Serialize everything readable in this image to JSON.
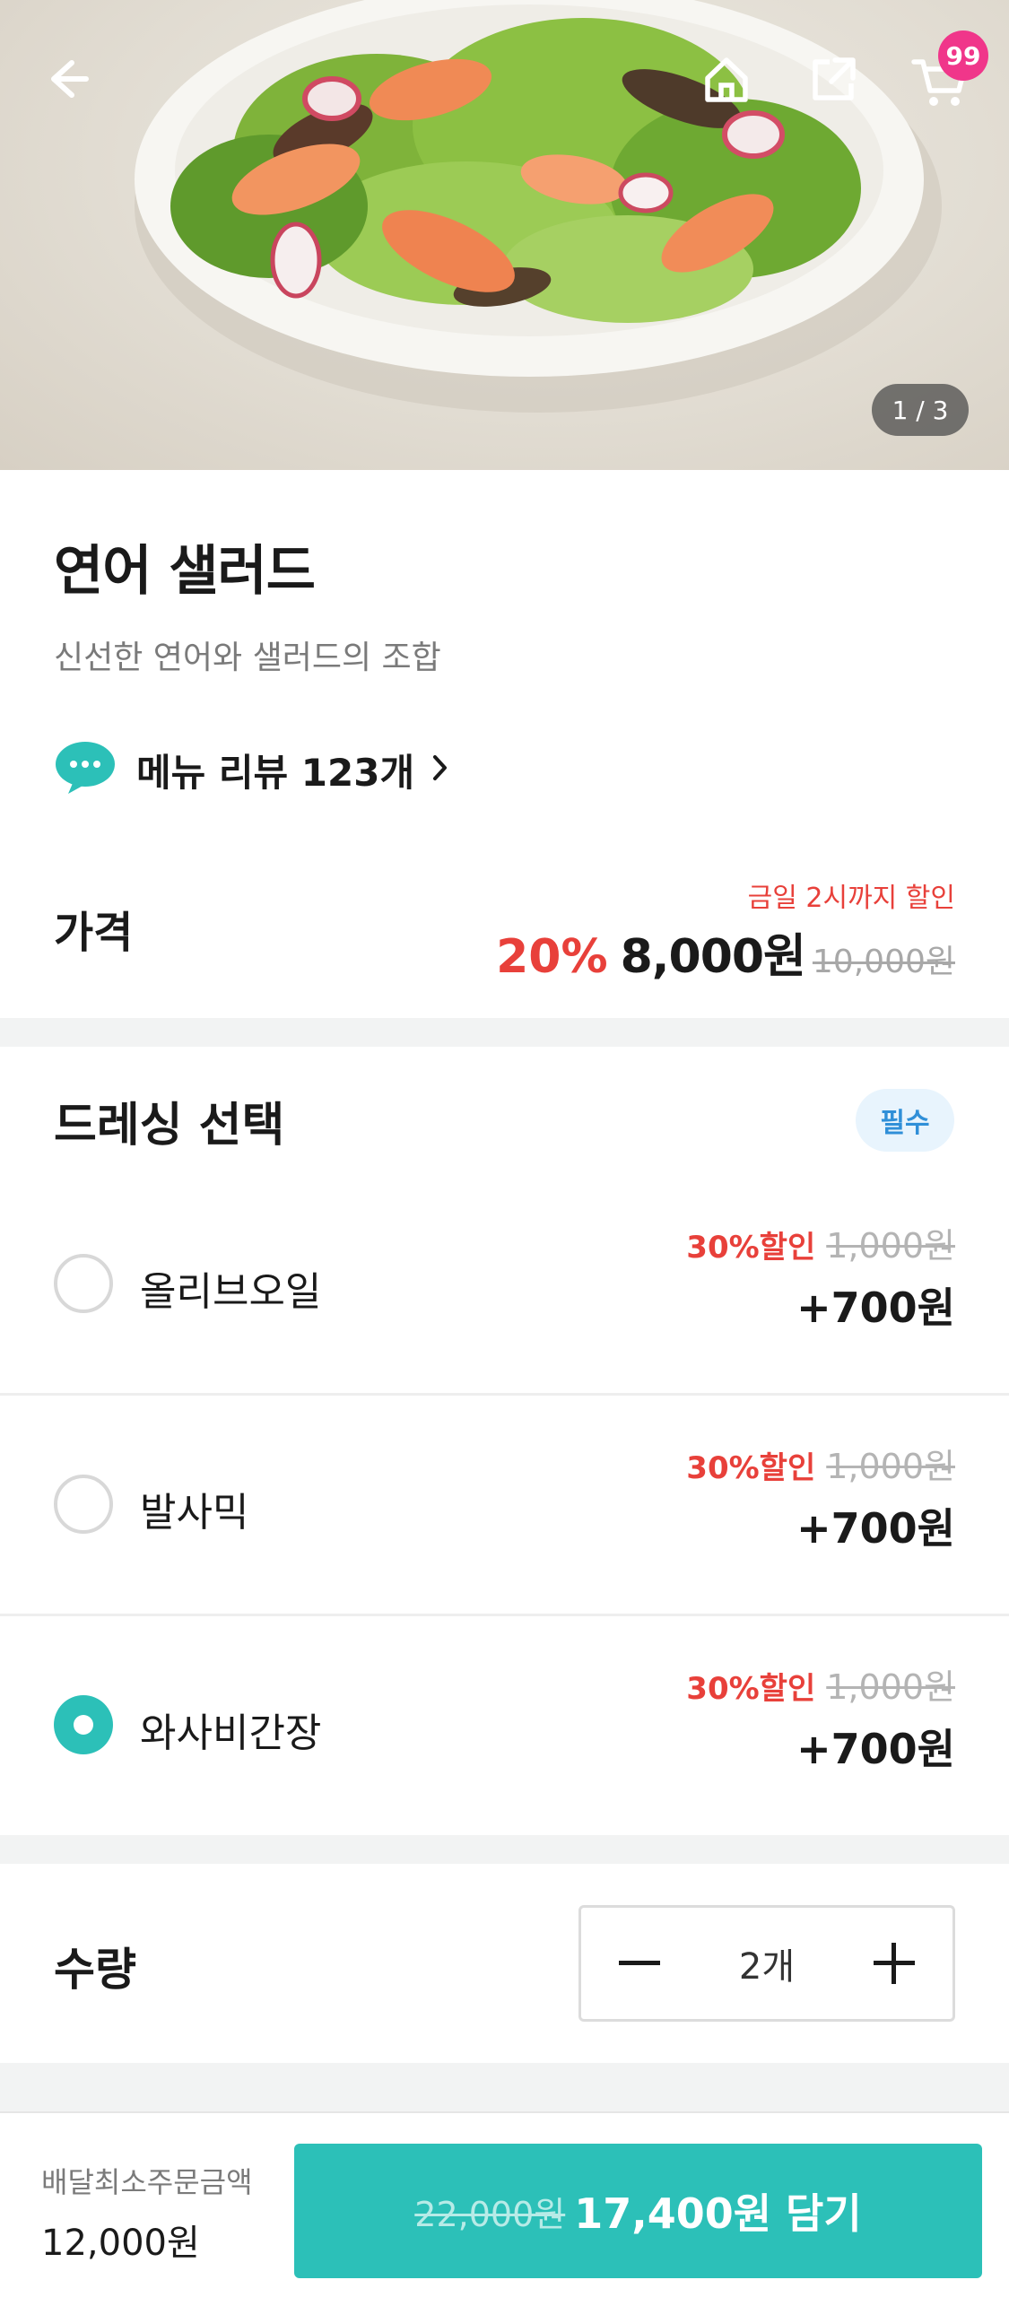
{
  "hero": {
    "image_counter": "1 / 3",
    "cart_count": "99",
    "icons": [
      "back-arrow-icon",
      "home-icon",
      "share-icon",
      "cart-icon"
    ]
  },
  "product": {
    "title": "연어 샐러드",
    "subtitle": "신선한 연어와 샐러드의 조합",
    "review_text": "메뉴 리뷰 123개",
    "price_label": "가격",
    "discount_note": "금일 2시까지 할인",
    "discount_rate": "20%",
    "price": "8,000원",
    "original_price": "10,000원"
  },
  "dressing": {
    "title": "드레싱 선택",
    "required_badge": "필수",
    "options": [
      {
        "name": "올리브오일",
        "discount": "30%할인",
        "original": "1,000원",
        "price": "+700원",
        "selected": false
      },
      {
        "name": "발사믹",
        "discount": "30%할인",
        "original": "1,000원",
        "price": "+700원",
        "selected": false
      },
      {
        "name": "와사비간장",
        "discount": "30%할인",
        "original": "1,000원",
        "price": "+700원",
        "selected": true
      }
    ]
  },
  "quantity": {
    "label": "수량",
    "value": "2개"
  },
  "bottom": {
    "min_order_label": "배달최소주문금액",
    "min_order_value": "12,000원",
    "old_total": "22,000원",
    "cta_label": "17,400원 담기"
  },
  "colors": {
    "accent": "#2cc0b8",
    "discount_red": "#e8403a",
    "badge_pink": "#f0368a",
    "required_blue": "#2f8fd8"
  }
}
